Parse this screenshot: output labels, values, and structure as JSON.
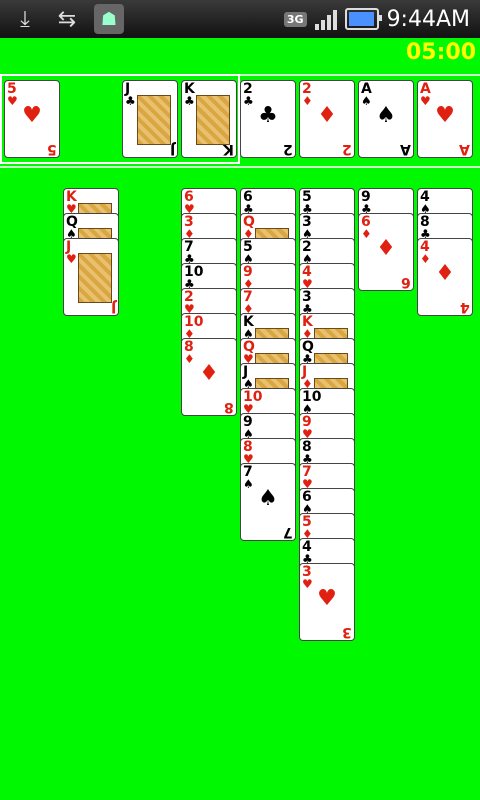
{
  "status_bar": {
    "time": "9:44AM",
    "network": "3G",
    "icons": [
      "download-done-icon",
      "usb-icon",
      "android-debug-icon"
    ]
  },
  "game": {
    "timer": "05:00",
    "colors": {
      "felt": "#00f800",
      "timer": "#ffff00",
      "red_suit": "#e02010"
    },
    "freecells": [
      {
        "rank": "5",
        "suit": "♥",
        "color": "red"
      },
      null,
      {
        "rank": "J",
        "suit": "♣",
        "color": "black",
        "face": true
      },
      {
        "rank": "K",
        "suit": "♣",
        "color": "black",
        "face": true
      }
    ],
    "foundations": [
      {
        "rank": "2",
        "suit": "♣",
        "color": "black"
      },
      {
        "rank": "2",
        "suit": "♦",
        "color": "red"
      },
      {
        "rank": "A",
        "suit": "♠",
        "color": "black"
      },
      {
        "rank": "A",
        "suit": "♥",
        "color": "red"
      }
    ],
    "tableau": [
      [],
      [
        {
          "rank": "K",
          "suit": "♥",
          "color": "red",
          "face": true
        },
        {
          "rank": "Q",
          "suit": "♠",
          "color": "black",
          "face": true
        },
        {
          "rank": "J",
          "suit": "♥",
          "color": "red",
          "face": true
        }
      ],
      [],
      [
        {
          "rank": "6",
          "suit": "♥",
          "color": "red"
        },
        {
          "rank": "3",
          "suit": "♦",
          "color": "red"
        },
        {
          "rank": "7",
          "suit": "♣",
          "color": "black"
        },
        {
          "rank": "10",
          "suit": "♣",
          "color": "black"
        },
        {
          "rank": "2",
          "suit": "♥",
          "color": "red"
        },
        {
          "rank": "10",
          "suit": "♦",
          "color": "red"
        },
        {
          "rank": "8",
          "suit": "♦",
          "color": "red"
        }
      ],
      [
        {
          "rank": "6",
          "suit": "♣",
          "color": "black"
        },
        {
          "rank": "Q",
          "suit": "♦",
          "color": "red",
          "face": true
        },
        {
          "rank": "5",
          "suit": "♠",
          "color": "black"
        },
        {
          "rank": "9",
          "suit": "♦",
          "color": "red"
        },
        {
          "rank": "7",
          "suit": "♦",
          "color": "red"
        },
        {
          "rank": "K",
          "suit": "♠",
          "color": "black",
          "face": true
        },
        {
          "rank": "Q",
          "suit": "♥",
          "color": "red",
          "face": true
        },
        {
          "rank": "J",
          "suit": "♠",
          "color": "black",
          "face": true
        },
        {
          "rank": "10",
          "suit": "♥",
          "color": "red"
        },
        {
          "rank": "9",
          "suit": "♠",
          "color": "black"
        },
        {
          "rank": "8",
          "suit": "♥",
          "color": "red"
        },
        {
          "rank": "7",
          "suit": "♠",
          "color": "black"
        }
      ],
      [
        {
          "rank": "5",
          "suit": "♣",
          "color": "black"
        },
        {
          "rank": "3",
          "suit": "♠",
          "color": "black"
        },
        {
          "rank": "2",
          "suit": "♠",
          "color": "black"
        },
        {
          "rank": "4",
          "suit": "♥",
          "color": "red"
        },
        {
          "rank": "3",
          "suit": "♣",
          "color": "black"
        },
        {
          "rank": "K",
          "suit": "♦",
          "color": "red",
          "face": true
        },
        {
          "rank": "Q",
          "suit": "♣",
          "color": "black",
          "face": true
        },
        {
          "rank": "J",
          "suit": "♦",
          "color": "red",
          "face": true
        },
        {
          "rank": "10",
          "suit": "♠",
          "color": "black"
        },
        {
          "rank": "9",
          "suit": "♥",
          "color": "red"
        },
        {
          "rank": "8",
          "suit": "♣",
          "color": "black"
        },
        {
          "rank": "7",
          "suit": "♥",
          "color": "red"
        },
        {
          "rank": "6",
          "suit": "♠",
          "color": "black"
        },
        {
          "rank": "5",
          "suit": "♦",
          "color": "red"
        },
        {
          "rank": "4",
          "suit": "♣",
          "color": "black"
        },
        {
          "rank": "3",
          "suit": "♥",
          "color": "red"
        }
      ],
      [
        {
          "rank": "9",
          "suit": "♣",
          "color": "black"
        },
        {
          "rank": "6",
          "suit": "♦",
          "color": "red"
        }
      ],
      [
        {
          "rank": "4",
          "suit": "♠",
          "color": "black"
        },
        {
          "rank": "8",
          "suit": "♣",
          "color": "black"
        },
        {
          "rank": "4",
          "suit": "♦",
          "color": "red"
        }
      ]
    ]
  }
}
